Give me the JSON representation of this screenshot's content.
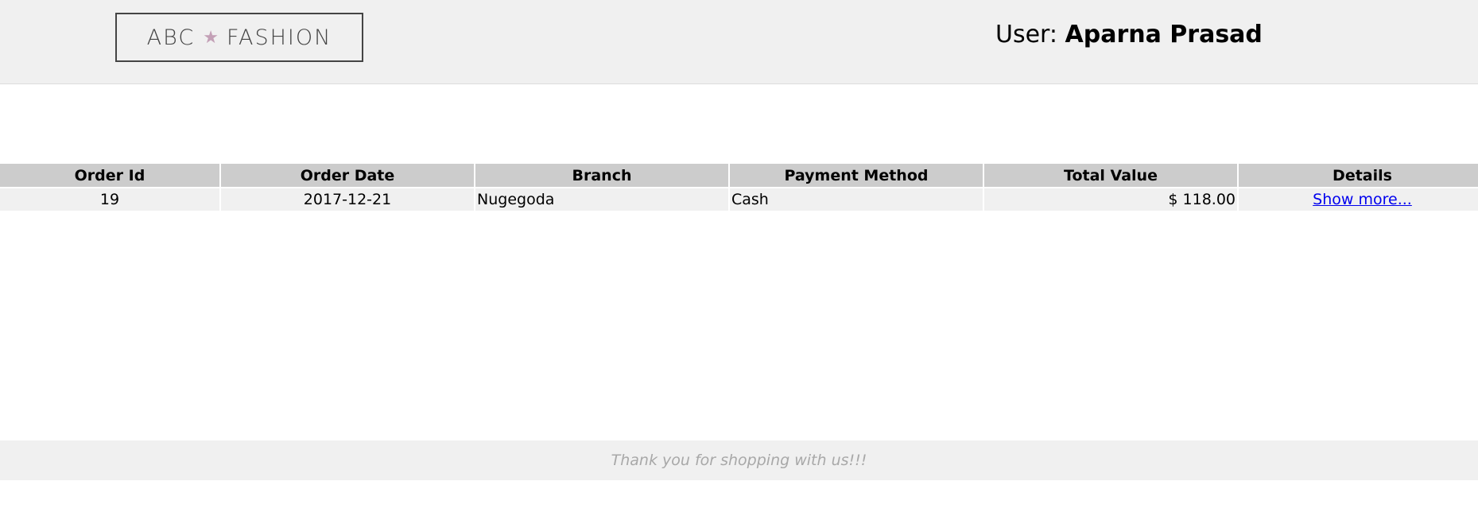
{
  "header": {
    "logo_left": "ABC",
    "logo_right": "FASHION",
    "logo_star_icon": "star-icon",
    "user_prefix": "User:",
    "user_name": "Aparna Prasad"
  },
  "orders_table": {
    "columns": [
      "Order Id",
      "Order Date",
      "Branch",
      "Payment Method",
      "Total Value",
      "Details"
    ],
    "rows": [
      {
        "order_id": "19",
        "order_date": "2017-12-21",
        "branch": "Nugegoda",
        "payment_method": "Cash",
        "total_value": "$ 118.00",
        "details_link": "Show more..."
      }
    ]
  },
  "footer": {
    "message": "Thank you for shopping with us!!!"
  },
  "colors": {
    "header_bg": "#f0f0f0",
    "table_header_bg": "#cccccc",
    "table_row_bg": "#f0f0f0",
    "link": "#0000ee",
    "footer_text": "#a8a8a8",
    "logo_star": "#c3a0b6"
  }
}
